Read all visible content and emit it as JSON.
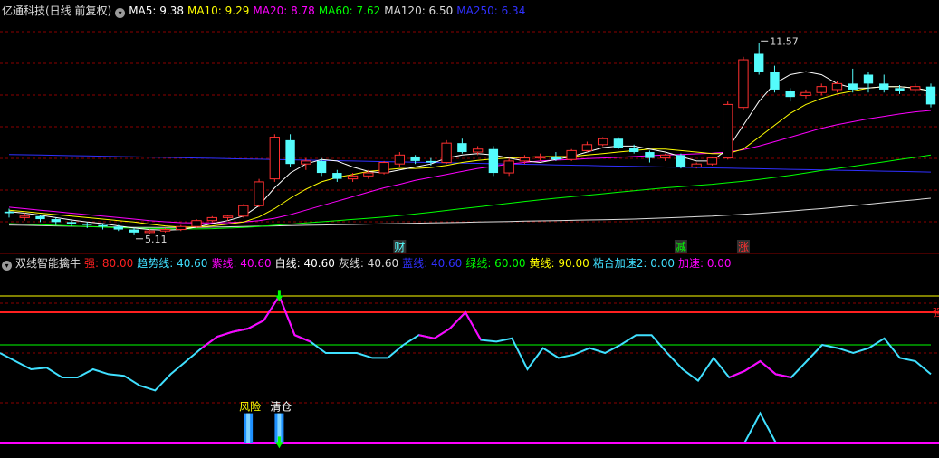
{
  "main_header": {
    "title": "亿通科技(日线 前复权)",
    "ma": [
      {
        "label": "MA5: 9.38",
        "color": "#ffffff"
      },
      {
        "label": "MA10: 9.29",
        "color": "#ffff00"
      },
      {
        "label": "MA20: 8.78",
        "color": "#ff00ff"
      },
      {
        "label": "MA60: 7.62",
        "color": "#00ff00"
      },
      {
        "label": "MA120: 6.50",
        "color": "#dcdcdc"
      },
      {
        "label": "MA250: 6.34",
        "color": "#3030ff"
      }
    ]
  },
  "sub_header": {
    "title": "双线智能擒牛",
    "items": [
      {
        "label": "强: 80.00",
        "color": "#ff2020"
      },
      {
        "label": "趋势线: 40.60",
        "color": "#40e0ff"
      },
      {
        "label": "紫线: 40.60",
        "color": "#ff00ff"
      },
      {
        "label": "白线: 40.60",
        "color": "#ffffff"
      },
      {
        "label": "灰线: 40.60",
        "color": "#dcdcdc"
      },
      {
        "label": "蓝线: 40.60",
        "color": "#3030ff"
      },
      {
        "label": "绿线: 60.00",
        "color": "#00ff00"
      },
      {
        "label": "黄线: 90.00",
        "color": "#ffff00"
      },
      {
        "label": "粘合加速2: 0.00",
        "color": "#40e0ff"
      },
      {
        "label": "加速: 0.00",
        "color": "#ff00ff"
      }
    ]
  },
  "colors": {
    "up": "#ff3030",
    "down": "#54fcfc",
    "grid": "#8b0000",
    "ma5": "#ffffff",
    "ma10": "#ffff00",
    "ma20": "#ff00ff",
    "ma60": "#00ff00",
    "ma120": "#dcdcdc",
    "ma250": "#3030ff",
    "strong": "#ff2020",
    "trend": "#40e0ff",
    "purple": "#ff00ff",
    "green": "#00ff00",
    "yellow": "#ffff00"
  },
  "chart_data": [
    {
      "type": "candlestick",
      "ylim": [
        4.8,
        12.4
      ],
      "annotations": [
        {
          "text": "11.57",
          "index": 48,
          "value": 11.57
        },
        {
          "text": "5.11",
          "index": 8,
          "value": 5.11
        }
      ],
      "markers": [
        {
          "text": "财",
          "index": 25,
          "color": "#54fcfc"
        },
        {
          "text": "减",
          "index": 43,
          "color": "#00ff00"
        },
        {
          "text": "涨",
          "index": 47,
          "color": "#ff3030"
        }
      ],
      "candles": [
        [
          5.9,
          5.85,
          6.0,
          5.7
        ],
        [
          5.7,
          5.75,
          5.85,
          5.6
        ],
        [
          5.75,
          5.65,
          5.8,
          5.55
        ],
        [
          5.65,
          5.55,
          5.7,
          5.45
        ],
        [
          5.55,
          5.5,
          5.6,
          5.4
        ],
        [
          5.5,
          5.45,
          5.55,
          5.35
        ],
        [
          5.45,
          5.4,
          5.5,
          5.3
        ],
        [
          5.4,
          5.3,
          5.45,
          5.25
        ],
        [
          5.3,
          5.2,
          5.35,
          5.11
        ],
        [
          5.2,
          5.25,
          5.3,
          5.15
        ],
        [
          5.25,
          5.3,
          5.35,
          5.2
        ],
        [
          5.3,
          5.4,
          5.45,
          5.25
        ],
        [
          5.4,
          5.6,
          5.65,
          5.35
        ],
        [
          5.6,
          5.7,
          5.75,
          5.55
        ],
        [
          5.7,
          5.75,
          5.8,
          5.6
        ],
        [
          5.75,
          6.1,
          6.15,
          5.7
        ],
        [
          6.1,
          6.9,
          7.0,
          6.05
        ],
        [
          7.0,
          8.4,
          8.5,
          6.9
        ],
        [
          8.3,
          7.5,
          8.5,
          7.4
        ],
        [
          7.5,
          7.6,
          7.7,
          7.3
        ],
        [
          7.6,
          7.2,
          7.7,
          7.1
        ],
        [
          7.2,
          7.0,
          7.3,
          6.9
        ],
        [
          7.0,
          7.1,
          7.2,
          6.9
        ],
        [
          7.1,
          7.2,
          7.3,
          7.0
        ],
        [
          7.2,
          7.55,
          7.6,
          7.15
        ],
        [
          7.5,
          7.8,
          7.9,
          7.4
        ],
        [
          7.75,
          7.6,
          7.8,
          7.5
        ],
        [
          7.6,
          7.55,
          7.7,
          7.45
        ],
        [
          7.55,
          8.2,
          8.3,
          7.5
        ],
        [
          8.2,
          7.9,
          8.35,
          7.85
        ],
        [
          7.9,
          8.0,
          8.1,
          7.8
        ],
        [
          8.0,
          7.2,
          8.1,
          7.1
        ],
        [
          7.2,
          7.6,
          7.7,
          7.1
        ],
        [
          7.6,
          7.7,
          7.8,
          7.5
        ],
        [
          7.7,
          7.75,
          7.85,
          7.6
        ],
        [
          7.75,
          7.65,
          7.9,
          7.6
        ],
        [
          7.65,
          7.95,
          8.0,
          7.6
        ],
        [
          7.95,
          8.15,
          8.25,
          7.9
        ],
        [
          8.15,
          8.35,
          8.4,
          8.1
        ],
        [
          8.35,
          8.05,
          8.4,
          8.0
        ],
        [
          8.05,
          7.9,
          8.15,
          7.85
        ],
        [
          7.9,
          7.7,
          7.95,
          7.55
        ],
        [
          7.7,
          7.8,
          7.85,
          7.6
        ],
        [
          7.8,
          7.4,
          7.85,
          7.35
        ],
        [
          7.4,
          7.5,
          7.55,
          7.35
        ],
        [
          7.5,
          7.7,
          7.75,
          7.45
        ],
        [
          7.7,
          9.5,
          9.6,
          7.65
        ],
        [
          9.4,
          11.0,
          11.1,
          9.3
        ],
        [
          11.2,
          10.6,
          11.57,
          10.5
        ],
        [
          10.6,
          10.0,
          10.8,
          9.9
        ],
        [
          9.95,
          9.75,
          10.05,
          9.6
        ],
        [
          9.8,
          9.9,
          10.0,
          9.7
        ],
        [
          9.9,
          10.1,
          10.2,
          9.8
        ],
        [
          10.0,
          10.2,
          10.3,
          9.9
        ],
        [
          10.2,
          10.0,
          10.7,
          9.9
        ],
        [
          10.5,
          10.2,
          10.6,
          9.9
        ],
        [
          10.2,
          10.0,
          10.5,
          9.9
        ],
        [
          10.05,
          9.95,
          10.15,
          9.85
        ],
        [
          10.0,
          10.1,
          10.2,
          9.9
        ],
        [
          10.1,
          9.5,
          10.2,
          9.4
        ]
      ],
      "ma5": [
        5.9,
        5.85,
        5.78,
        5.7,
        5.62,
        5.55,
        5.5,
        5.42,
        5.35,
        5.3,
        5.28,
        5.3,
        5.38,
        5.5,
        5.6,
        5.75,
        6.1,
        6.7,
        7.2,
        7.5,
        7.65,
        7.6,
        7.4,
        7.25,
        7.2,
        7.3,
        7.4,
        7.5,
        7.7,
        7.8,
        7.85,
        7.8,
        7.7,
        7.6,
        7.55,
        7.65,
        7.75,
        7.9,
        8.05,
        8.1,
        8.1,
        8.0,
        7.9,
        7.75,
        7.6,
        7.6,
        8.0,
        8.8,
        9.6,
        10.2,
        10.5,
        10.6,
        10.5,
        10.2,
        10.05,
        10.05,
        10.1,
        10.1,
        10.05,
        9.95
      ],
      "ma10": [
        5.95,
        5.9,
        5.85,
        5.8,
        5.75,
        5.7,
        5.65,
        5.6,
        5.55,
        5.48,
        5.42,
        5.38,
        5.38,
        5.42,
        5.48,
        5.55,
        5.72,
        6.0,
        6.35,
        6.65,
        6.9,
        7.05,
        7.15,
        7.25,
        7.3,
        7.35,
        7.35,
        7.38,
        7.45,
        7.55,
        7.62,
        7.67,
        7.7,
        7.72,
        7.75,
        7.75,
        7.75,
        7.8,
        7.85,
        7.9,
        7.95,
        8.0,
        8.0,
        7.95,
        7.9,
        7.85,
        7.85,
        8.0,
        8.4,
        8.8,
        9.2,
        9.5,
        9.7,
        9.85,
        9.95,
        10.05,
        10.1,
        10.1,
        10.05,
        9.95
      ],
      "ma20": [
        6.05,
        6.0,
        5.95,
        5.9,
        5.85,
        5.8,
        5.75,
        5.7,
        5.65,
        5.6,
        5.56,
        5.53,
        5.52,
        5.52,
        5.53,
        5.55,
        5.6,
        5.68,
        5.8,
        5.95,
        6.1,
        6.25,
        6.4,
        6.55,
        6.7,
        6.82,
        6.95,
        7.05,
        7.15,
        7.25,
        7.35,
        7.42,
        7.5,
        7.55,
        7.6,
        7.63,
        7.65,
        7.68,
        7.7,
        7.72,
        7.75,
        7.78,
        7.8,
        7.82,
        7.84,
        7.86,
        7.9,
        7.98,
        8.1,
        8.25,
        8.4,
        8.55,
        8.7,
        8.82,
        8.92,
        9.02,
        9.1,
        9.18,
        9.25,
        9.3
      ],
      "ma60": [
        5.5,
        5.48,
        5.46,
        5.44,
        5.42,
        5.4,
        5.38,
        5.36,
        5.35,
        5.34,
        5.33,
        5.32,
        5.32,
        5.33,
        5.35,
        5.37,
        5.4,
        5.44,
        5.48,
        5.52,
        5.56,
        5.6,
        5.64,
        5.68,
        5.72,
        5.77,
        5.82,
        5.88,
        5.94,
        6.0,
        6.06,
        6.12,
        6.18,
        6.24,
        6.3,
        6.35,
        6.4,
        6.45,
        6.5,
        6.55,
        6.6,
        6.65,
        6.7,
        6.74,
        6.78,
        6.82,
        6.87,
        6.92,
        6.98,
        7.05,
        7.12,
        7.2,
        7.28,
        7.35,
        7.42,
        7.5,
        7.57,
        7.65,
        7.72,
        7.8
      ],
      "ma120": [
        5.45,
        5.44,
        5.43,
        5.42,
        5.41,
        5.4,
        5.39,
        5.38,
        5.37,
        5.37,
        5.37,
        5.37,
        5.37,
        5.38,
        5.39,
        5.4,
        5.41,
        5.42,
        5.43,
        5.44,
        5.45,
        5.46,
        5.47,
        5.48,
        5.49,
        5.5,
        5.51,
        5.52,
        5.53,
        5.54,
        5.55,
        5.56,
        5.57,
        5.58,
        5.59,
        5.6,
        5.61,
        5.62,
        5.63,
        5.64,
        5.65,
        5.67,
        5.69,
        5.71,
        5.73,
        5.75,
        5.78,
        5.81,
        5.84,
        5.88,
        5.92,
        5.96,
        6.0,
        6.05,
        6.1,
        6.15,
        6.2,
        6.25,
        6.3,
        6.35
      ],
      "ma250": [
        7.82,
        7.81,
        7.8,
        7.79,
        7.78,
        7.77,
        7.76,
        7.75,
        7.74,
        7.73,
        7.72,
        7.71,
        7.7,
        7.69,
        7.68,
        7.67,
        7.66,
        7.65,
        7.64,
        7.63,
        7.62,
        7.61,
        7.6,
        7.59,
        7.58,
        7.57,
        7.56,
        7.55,
        7.54,
        7.53,
        7.52,
        7.51,
        7.5,
        7.49,
        7.48,
        7.47,
        7.46,
        7.45,
        7.44,
        7.43,
        7.42,
        7.41,
        7.4,
        7.39,
        7.38,
        7.37,
        7.36,
        7.35,
        7.34,
        7.33,
        7.32,
        7.31,
        7.3,
        7.29,
        7.28,
        7.27,
        7.26,
        7.25,
        7.24,
        7.23
      ]
    },
    {
      "type": "line",
      "ylim": [
        -5,
        105
      ],
      "right_label": "强",
      "annotations": [
        {
          "text": "风险",
          "index": 16,
          "color": "#ffff00"
        },
        {
          "text": "清仓",
          "index": 18,
          "color": "#ffffff"
        }
      ],
      "strong_level": 80.0,
      "yellow_level": 90.0,
      "trend": [
        55,
        50,
        45,
        46,
        40,
        40,
        45,
        42,
        41,
        35,
        32,
        42,
        50,
        58,
        65,
        68,
        70,
        75,
        90,
        66,
        62,
        55,
        55,
        55,
        52,
        52,
        60,
        66,
        64,
        70,
        80,
        63,
        62,
        64,
        45,
        58,
        52,
        54,
        58,
        55,
        60,
        66,
        66,
        55,
        45,
        38,
        52,
        40,
        44,
        50,
        42,
        40,
        50,
        60,
        58,
        55,
        58,
        64,
        52,
        50,
        42
      ],
      "green_line": [
        60,
        60,
        60,
        60,
        60,
        60,
        60,
        60,
        60,
        60,
        60,
        60,
        60,
        60,
        60,
        60,
        60,
        60,
        60,
        60,
        60,
        60,
        60,
        60,
        60,
        60,
        60,
        60,
        60,
        60,
        60,
        60,
        60,
        60,
        60,
        60,
        60,
        60,
        60,
        60,
        60,
        60,
        60,
        60,
        60,
        60,
        60,
        60,
        60,
        60,
        60,
        60,
        60,
        60,
        60,
        60,
        60,
        60,
        60,
        60,
        60
      ],
      "purple_segments": [
        [
          13,
          18
        ],
        [
          18,
          20
        ],
        [
          27,
          31
        ],
        [
          47,
          51
        ]
      ],
      "accel_bars": [
        {
          "index": 16,
          "value": 18
        },
        {
          "index": 18,
          "value": 18
        }
      ],
      "accel_line": [
        0,
        0,
        0,
        0,
        0,
        0,
        0,
        0,
        0,
        0,
        0,
        0,
        0,
        0,
        0,
        0,
        0,
        0,
        0,
        0,
        0,
        0,
        0,
        0,
        0,
        0,
        0,
        0,
        0,
        0,
        0,
        0,
        0,
        0,
        0,
        0,
        0,
        0,
        0,
        0,
        0,
        0,
        0,
        0,
        0,
        0,
        0,
        0,
        0,
        18,
        0,
        0,
        0,
        0,
        0,
        0,
        0,
        0,
        0,
        0,
        0
      ]
    }
  ]
}
